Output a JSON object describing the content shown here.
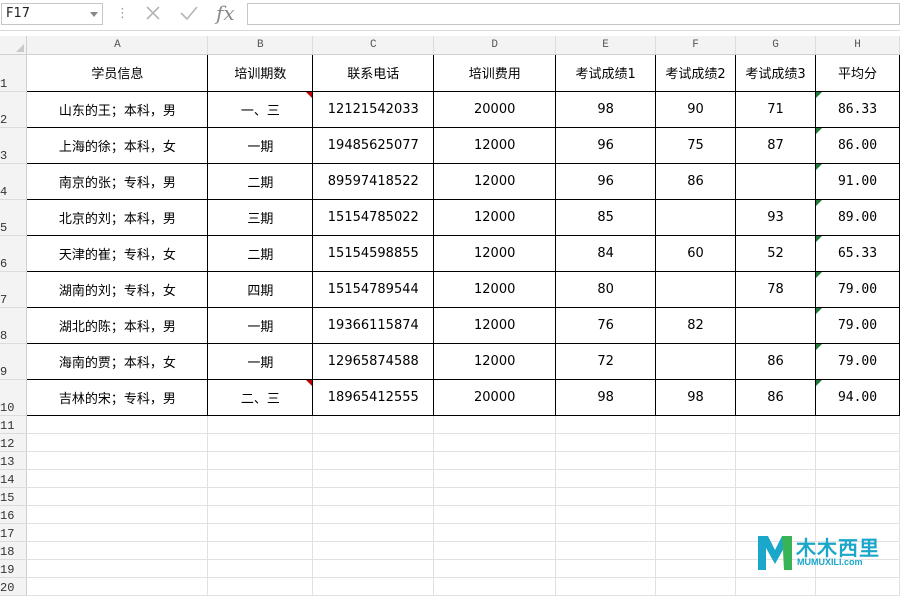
{
  "formula_bar": {
    "name_box": "F17",
    "fx_label": "fx",
    "formula": ""
  },
  "columns": [
    "A",
    "B",
    "C",
    "D",
    "E",
    "F",
    "G",
    "H"
  ],
  "row_numbers": [
    "1",
    "2",
    "3",
    "4",
    "5",
    "6",
    "7",
    "8",
    "9",
    "10",
    "11",
    "12",
    "13",
    "14",
    "15",
    "16",
    "17",
    "18",
    "19",
    "20"
  ],
  "headers": [
    "学员信息",
    "培训期数",
    "联系电话",
    "培训费用",
    "考试成绩1",
    "考试成绩2",
    "考试成绩3",
    "平均分"
  ],
  "rows": [
    [
      "山东的王；本科，男",
      "一、三",
      "12121542033",
      "20000",
      "98",
      "90",
      "71",
      "86.33"
    ],
    [
      "上海的徐；本科，女",
      "一期",
      "19485625077",
      "12000",
      "96",
      "75",
      "87",
      "86.00"
    ],
    [
      "南京的张；专科，男",
      "二期",
      "89597418522",
      "12000",
      "96",
      "86",
      "",
      "91.00"
    ],
    [
      "北京的刘；本科，男",
      "三期",
      "15154785022",
      "12000",
      "85",
      "",
      "93",
      "89.00"
    ],
    [
      "天津的崔；专科，女",
      "二期",
      "15154598855",
      "12000",
      "84",
      "60",
      "52",
      "65.33"
    ],
    [
      "湖南的刘；专科，女",
      "四期",
      "15154789544",
      "12000",
      "80",
      "",
      "78",
      "79.00"
    ],
    [
      "湖北的陈；本科，男",
      "一期",
      "19366115874",
      "12000",
      "76",
      "82",
      "",
      "79.00"
    ],
    [
      "海南的贾；本科，女",
      "一期",
      "12965874588",
      "12000",
      "72",
      "",
      "86",
      "79.00"
    ],
    [
      "吉林的宋；专科，男",
      "二、三",
      "18965412555",
      "20000",
      "98",
      "98",
      "86",
      "94.00"
    ]
  ],
  "comment_marker_rows": [
    0,
    8
  ],
  "watermark": {
    "text": "木木西里",
    "sub": "MUMUXILI.com",
    "colors": {
      "teal": "#1aa7c9",
      "green": "#3db54a"
    }
  },
  "colors": {
    "comment_marker": "#c00000",
    "error_marker": "#1f7a3a",
    "header_bg": "#f3f3f3"
  }
}
